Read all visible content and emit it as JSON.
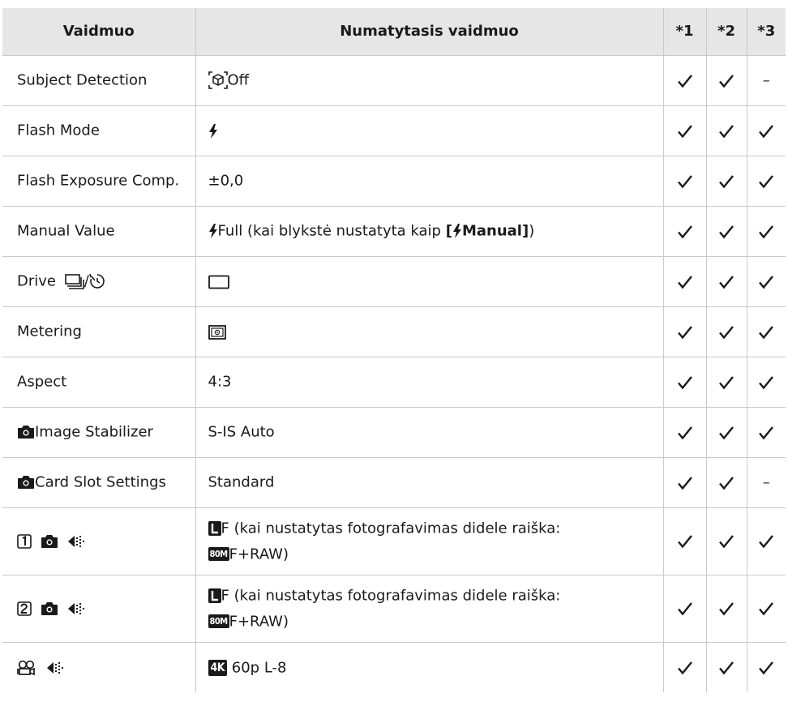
{
  "table": {
    "headers": [
      "Vaidmuo",
      "Numatytasis vaidmuo",
      "*1",
      "*2",
      "*3"
    ],
    "rows": [
      {
        "mode": "Subject Detection",
        "default": "Off",
        "flags": [
          "check",
          "check",
          "dash"
        ]
      },
      {
        "mode": "Flash Mode",
        "default": "",
        "flags": [
          "check",
          "check",
          "check"
        ]
      },
      {
        "mode": "Flash Exposure Comp.",
        "default": "±0,0",
        "flags": [
          "check",
          "check",
          "check"
        ]
      },
      {
        "mode": "Manual Value",
        "default_pre": "Full (kai blykstė nustatyta kaip ",
        "default_bracket_open": "[",
        "default_bold": "Manual",
        "default_bracket_close": "]",
        "default_post": ")",
        "flags": [
          "check",
          "check",
          "check"
        ]
      },
      {
        "mode": "Drive",
        "mode_sep": "/",
        "default": "",
        "flags": [
          "check",
          "check",
          "check"
        ]
      },
      {
        "mode": "Metering",
        "default": "",
        "flags": [
          "check",
          "check",
          "check"
        ]
      },
      {
        "mode": "Aspect",
        "default": "4:3",
        "flags": [
          "check",
          "check",
          "check"
        ]
      },
      {
        "mode": "Image Stabilizer",
        "default": "S-IS Auto",
        "flags": [
          "check",
          "check",
          "check"
        ]
      },
      {
        "mode": "Card Slot Settings",
        "default": "Standard",
        "flags": [
          "check",
          "check",
          "dash"
        ]
      },
      {
        "mode": "",
        "default_line1": "F (kai nustatytas fotografavimas didele raiška:",
        "default_badge": "80M",
        "default_line2": "F+RAW)",
        "flags": [
          "check",
          "check",
          "check"
        ]
      },
      {
        "mode": "",
        "default_line1": "F (kai nustatytas fotografavimas didele raiška:",
        "default_badge": "80M",
        "default_line2": "F+RAW)",
        "flags": [
          "check",
          "check",
          "check"
        ]
      },
      {
        "mode": "",
        "default_badge": "4K",
        "default": "60p L-8",
        "flags": [
          "check",
          "check",
          "check"
        ]
      }
    ],
    "dash_symbol": "–"
  },
  "icons": {
    "subject_detection": "face-detection-off-icon",
    "flash": "flash-icon",
    "drive_sequential": "sequential-shooting-icon",
    "drive_self_timer": "self-timer-icon",
    "single_frame": "single-frame-icon",
    "metering": "esp-metering-icon",
    "camera": "camera-icon",
    "slot1": "card-slot-1-icon",
    "slot2": "card-slot-2-icon",
    "image_quality": "image-quality-icon",
    "large_size": "large-size-icon",
    "movie": "movie-icon"
  }
}
